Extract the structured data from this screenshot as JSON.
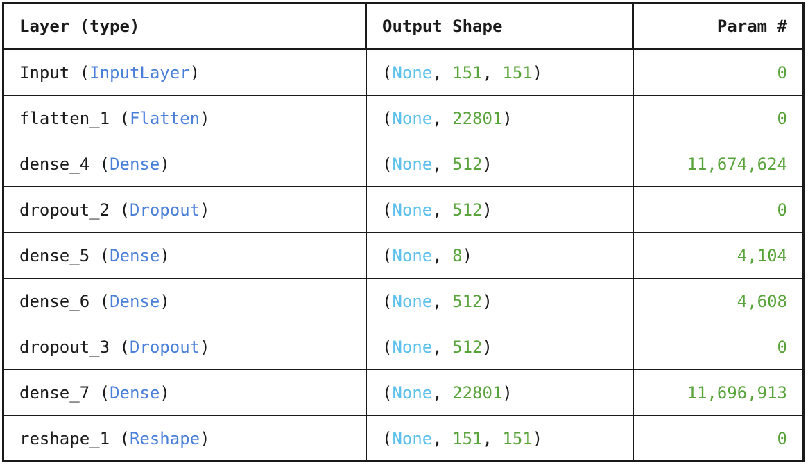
{
  "colors": {
    "layer_type": "#4a7fd9",
    "none_keyword": "#5bc0eb",
    "number": "#58a33a",
    "text": "#1a1a1a"
  },
  "header": {
    "layer": "Layer (type)",
    "output_shape": "Output Shape",
    "params": "Param #"
  },
  "rows": [
    {
      "name": "Input",
      "type": "InputLayer",
      "none": "None",
      "dims": [
        "151",
        "151"
      ],
      "params": "0"
    },
    {
      "name": "flatten_1",
      "type": "Flatten",
      "none": "None",
      "dims": [
        "22801"
      ],
      "params": "0"
    },
    {
      "name": "dense_4",
      "type": "Dense",
      "none": "None",
      "dims": [
        "512"
      ],
      "params": "11,674,624"
    },
    {
      "name": "dropout_2",
      "type": "Dropout",
      "none": "None",
      "dims": [
        "512"
      ],
      "params": "0"
    },
    {
      "name": "dense_5",
      "type": "Dense",
      "none": "None",
      "dims": [
        "8"
      ],
      "params": "4,104"
    },
    {
      "name": "dense_6",
      "type": "Dense",
      "none": "None",
      "dims": [
        "512"
      ],
      "params": "4,608"
    },
    {
      "name": "dropout_3",
      "type": "Dropout",
      "none": "None",
      "dims": [
        "512"
      ],
      "params": "0"
    },
    {
      "name": "dense_7",
      "type": "Dense",
      "none": "None",
      "dims": [
        "22801"
      ],
      "params": "11,696,913"
    },
    {
      "name": "reshape_1",
      "type": "Reshape",
      "none": "None",
      "dims": [
        "151",
        "151"
      ],
      "params": "0"
    }
  ]
}
